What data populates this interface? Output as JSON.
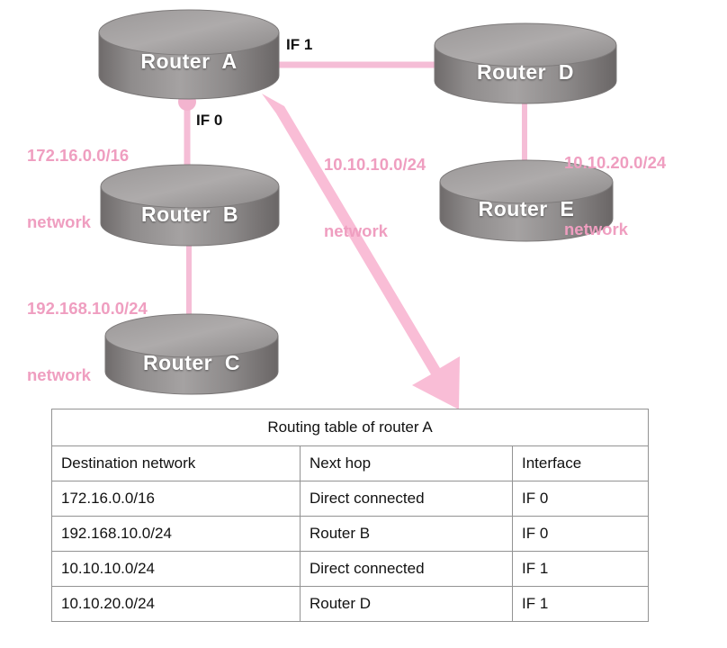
{
  "diagram": {
    "nodes": [
      {
        "id": "router-a",
        "label": "Router  A"
      },
      {
        "id": "router-b",
        "label": "Router  B"
      },
      {
        "id": "router-c",
        "label": "Router  C"
      },
      {
        "id": "router-d",
        "label": "Router  D"
      },
      {
        "id": "router-e",
        "label": "Router  E"
      }
    ],
    "interfaces": [
      {
        "id": "if1",
        "label": "IF 1"
      },
      {
        "id": "if0",
        "label": "IF 0"
      }
    ],
    "network_labels": [
      {
        "id": "net-172",
        "line1": "172.16.0.0/16",
        "line2": "network"
      },
      {
        "id": "net-192",
        "line1": "192.168.10.0/24",
        "line2": "network"
      },
      {
        "id": "net-10-10",
        "line1": "10.10.10.0/24",
        "line2": "network"
      },
      {
        "id": "net-10-20",
        "line1": "10.10.20.0/24",
        "line2": "network"
      }
    ],
    "colors": {
      "link_pink": "#f5bdd6",
      "label_pink": "#ef9ec0",
      "arrow_pink": "#f9bdd6",
      "router_dark": "#6e6a6a",
      "router_mid": "#8a8787",
      "router_light": "#a3a0a0",
      "table_border": "#939393"
    }
  },
  "routing_table": {
    "title": "Routing table of router A",
    "headers": [
      "Destination network",
      "Next hop",
      "Interface"
    ],
    "rows": [
      [
        "172.16.0.0/16",
        "Direct connected",
        "IF 0"
      ],
      [
        "192.168.10.0/24",
        "Router B",
        "IF 0"
      ],
      [
        "10.10.10.0/24",
        "Direct connected",
        "IF 1"
      ],
      [
        "10.10.20.0/24",
        "Router D",
        "IF 1"
      ]
    ]
  }
}
